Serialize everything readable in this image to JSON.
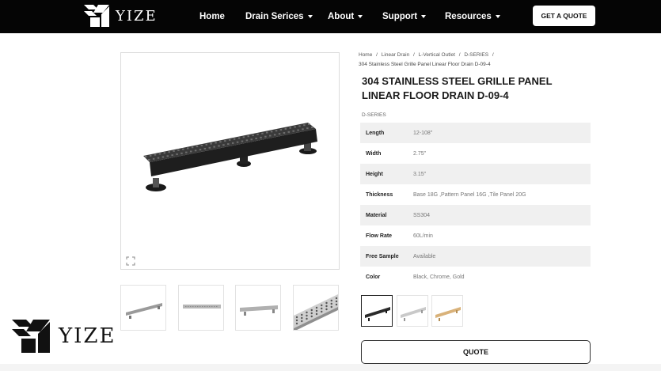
{
  "header": {
    "brand": "YIZE",
    "nav": [
      {
        "label": "Home",
        "dropdown": false
      },
      {
        "label": "Drain Serices",
        "dropdown": true
      },
      {
        "label": "About",
        "dropdown": true
      },
      {
        "label": "Support",
        "dropdown": true
      },
      {
        "label": "Resources",
        "dropdown": true
      }
    ],
    "cta": "GET A QUOTE"
  },
  "breadcrumb": {
    "items": [
      "Home",
      "/",
      "Linear Drain",
      "/",
      "L-Vertical Outlet",
      "/",
      "D-SERIES",
      "/"
    ],
    "current": "304 Stainless Steel Grille Panel Linear Floor Drain D-09-4"
  },
  "product": {
    "title": "304 STAINLESS STEEL GRILLE PANEL LINEAR FLOOR DRAIN D-09-4",
    "series": "D-SERIES",
    "specs": [
      {
        "label": "Length",
        "value": "12-108\""
      },
      {
        "label": "Width",
        "value": "2.75\""
      },
      {
        "label": "Height",
        "value": "3.15\""
      },
      {
        "label": "Thickness",
        "value": "Base 18G ,Pattern Panel 16G ,Tile Panel 20G"
      },
      {
        "label": "Material",
        "value": "SS304"
      },
      {
        "label": "Flow Rate",
        "value": "60L/min"
      },
      {
        "label": "Free Sample",
        "value": "Available"
      },
      {
        "label": "Color",
        "value": "Black, Chrome, Gold"
      }
    ],
    "swatches": [
      "black",
      "chrome",
      "gold"
    ],
    "selected_swatch": "black",
    "quote_button": "QUOTE"
  },
  "watermark": {
    "brand": "YIZE"
  },
  "colors": {
    "header_bg": "#050505",
    "black_finish": "#2a2a2a",
    "chrome_finish": "#c9c9c9",
    "gold_finish": "#d9b27a"
  },
  "icons": {
    "logo": "yize-logo-icon",
    "zoom": "expand-icon"
  }
}
